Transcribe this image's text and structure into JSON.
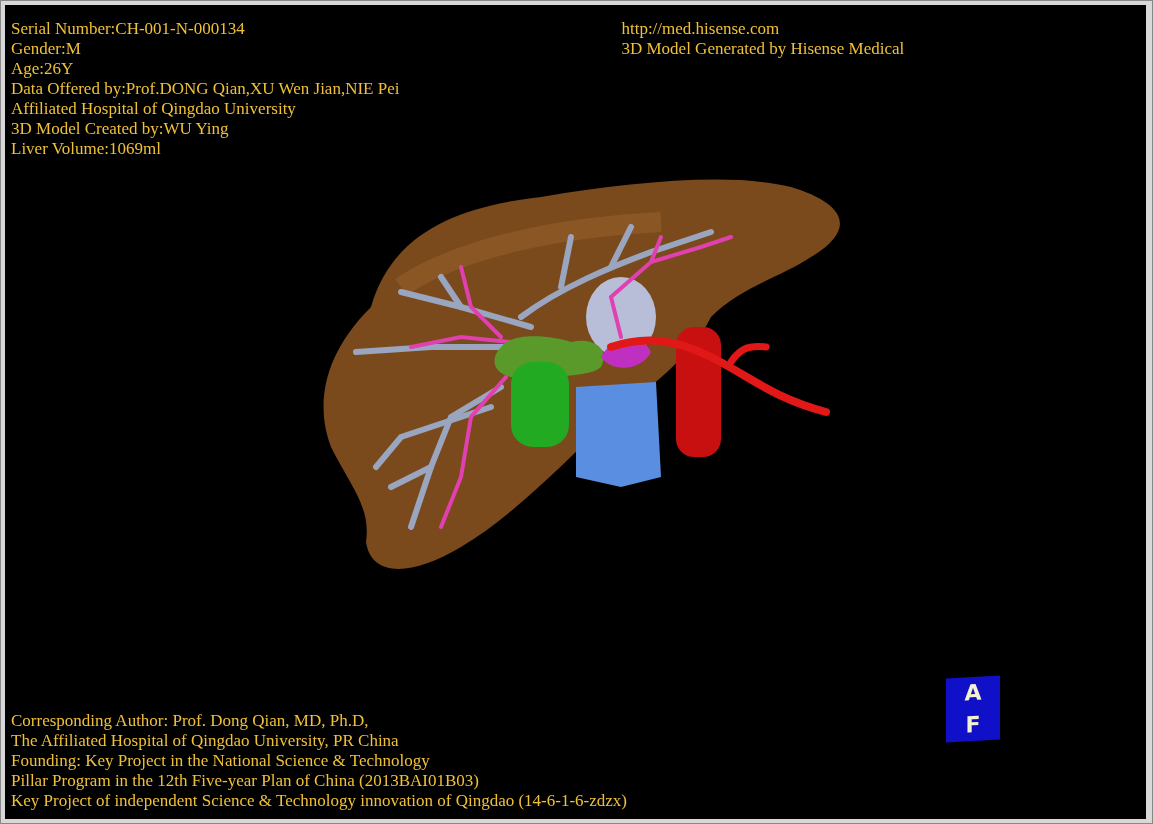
{
  "info_left": [
    "Serial Number:CH-001-N-000134",
    "Gender:M",
    "Age:26Y",
    "Data Offered by:Prof.DONG Qian,XU Wen Jian,NIE Pei",
    "Affiliated Hospital of Qingdao University",
    "3D Model Created by:WU Ying",
    "Liver Volume:1069ml"
  ],
  "info_right": [
    "http://med.hisense.com",
    "3D Model Generated by Hisense Medical"
  ],
  "credits": [
    "Corresponding Author: Prof. Dong Qian, MD, Ph.D,",
    "The Affiliated Hospital of Qingdao University, PR China",
    "Founding: Key Project in the National Science & Technology",
    "Pillar Program in the 12th Five-year Plan of China (2013BAI01B03)",
    "Key Project of independent Science & Technology innovation of Qingdao (14-6-1-6-zdzx)"
  ],
  "orientation_cube": {
    "top": "A",
    "front": "F"
  }
}
